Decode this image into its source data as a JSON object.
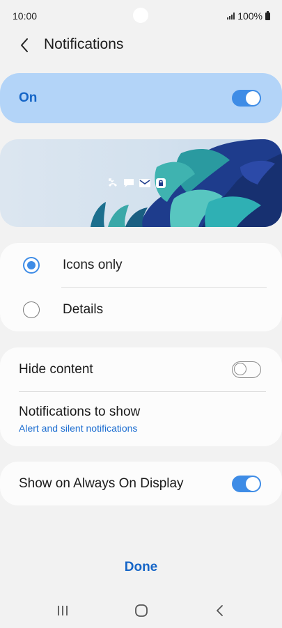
{
  "status_bar": {
    "time": "10:00",
    "battery": "100%"
  },
  "header": {
    "title": "Notifications",
    "back_icon": "chevron-left-icon"
  },
  "master_switch": {
    "label": "On",
    "enabled": true,
    "bg_color": "#b3d4f8",
    "accent_color": "#1565c7"
  },
  "preview": {
    "icons": [
      "missed-call-icon",
      "message-icon",
      "email-icon",
      "lock-icon"
    ]
  },
  "style_options": {
    "items": [
      {
        "label": "Icons only",
        "selected": true
      },
      {
        "label": "Details",
        "selected": false
      }
    ]
  },
  "settings": {
    "hide_content": {
      "label": "Hide content",
      "enabled": false
    },
    "notifications_to_show": {
      "label": "Notifications to show",
      "value": "Alert and silent notifications"
    },
    "always_on_display": {
      "label": "Show on Always On Display",
      "enabled": true
    }
  },
  "footer": {
    "done_label": "Done"
  },
  "nav_bar": {
    "icons": [
      "recent-apps-icon",
      "home-icon",
      "back-icon"
    ]
  },
  "colors": {
    "accent": "#3e8ce6",
    "link": "#1f6fd1",
    "background": "#f2f2f2"
  }
}
